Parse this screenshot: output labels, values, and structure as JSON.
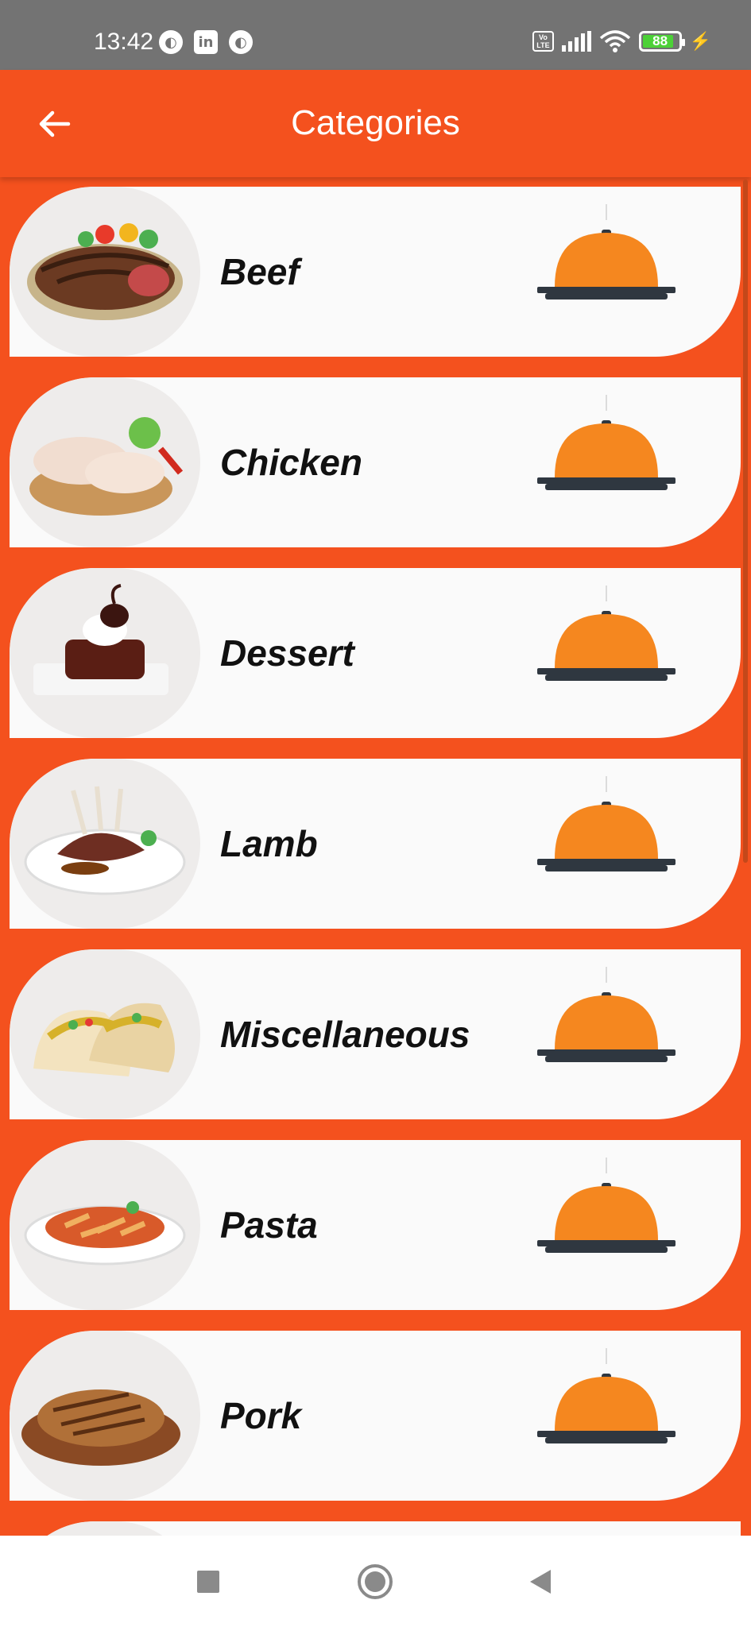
{
  "status_bar": {
    "time": "13:42",
    "battery": "88",
    "left_icons": [
      "app-icon",
      "linkedin-icon",
      "app-icon"
    ],
    "network": "Vo LTE"
  },
  "app_bar": {
    "title": "Categories",
    "back_icon": "arrow-left-icon"
  },
  "categories": [
    {
      "label": "Beef",
      "image": "steak-plate"
    },
    {
      "label": "Chicken",
      "image": "raw-chicken-legs"
    },
    {
      "label": "Dessert",
      "image": "chocolate-cake"
    },
    {
      "label": "Lamb",
      "image": "lamb-chops"
    },
    {
      "label": "Miscellaneous",
      "image": "tacos"
    },
    {
      "label": "Pasta",
      "image": "penne-pasta"
    },
    {
      "label": "Pork",
      "image": "pork-chop"
    }
  ],
  "colors": {
    "primary": "#f4511e",
    "card": "#fafafa",
    "cloche": "#f5871f",
    "tray": "#2f3740",
    "status_bar": "#737373"
  },
  "nav_bar": {
    "buttons": [
      "recents-square-icon",
      "home-circle-icon",
      "back-triangle-icon"
    ]
  }
}
